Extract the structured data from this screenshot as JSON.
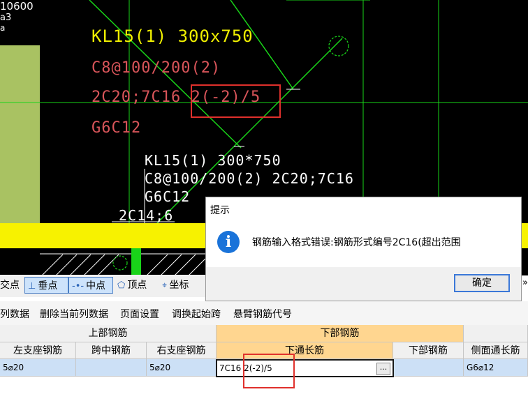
{
  "cad": {
    "annotation_large": {
      "line1": "KL15(1) 300x750",
      "line2": "C8@100/200(2)",
      "line3_prefix": "2C20;7C16",
      "line3_error": "2(-2)/5",
      "line4": "G6C12"
    },
    "annotation_small": {
      "line1": "KL15(1) 300*750",
      "line2": "C8@100/200(2) 2C20;7C16",
      "line3": "G6C12"
    },
    "partial_label": "2C14;6",
    "dimension_label": "10600",
    "axis_bubble_label": "a3",
    "small_bubble_label": "a",
    "colors": {
      "background": "#000000",
      "beam_yellow": "#f7f200",
      "line_green": "#19d419",
      "error_red": "#e0302c"
    }
  },
  "snap_toolbar": [
    {
      "label": "交点",
      "icon": "",
      "selected": false
    },
    {
      "label": "垂点",
      "icon": "perpendicular-icon",
      "selected": true
    },
    {
      "label": "中点",
      "icon": "midpoint-icon",
      "selected": true
    },
    {
      "label": "顶点",
      "icon": "pentagon-icon",
      "selected": false
    },
    {
      "label": "坐标",
      "icon": "coordinate-icon",
      "selected": false
    }
  ],
  "menu": [
    "列数据",
    "删除当前列数据",
    "页面设置",
    "调换起始跨",
    "悬臂钢筋代号"
  ],
  "table": {
    "group_headers": {
      "top": "上部钢筋",
      "bottom": "下部钢筋"
    },
    "columns": [
      "左支座钢筋",
      "跨中钢筋",
      "右支座钢筋",
      "下通长筋",
      "下部钢筋",
      "侧面通长筋"
    ],
    "row": {
      "left_support": "5⌀20",
      "mid_span": "",
      "right_support": "5⌀20",
      "bottom_through": "7C16 2(-2)/5",
      "bottom_rebar": "",
      "side_through": "G6⌀12"
    },
    "ellipsis_label": "..."
  },
  "dialog": {
    "title": "提示",
    "message": "钢筋输入格式错误:钢筋形式编号2C16(超出范围",
    "ok_label": "确定",
    "icon": "info-icon"
  },
  "scroll_arrow": "»"
}
